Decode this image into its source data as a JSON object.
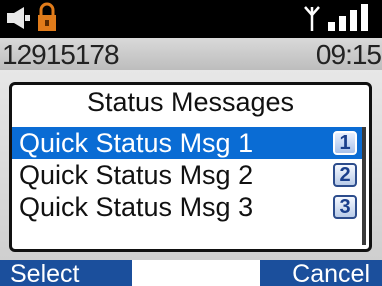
{
  "status_bar": {
    "icons": [
      "speaker-icon",
      "lock-icon",
      "antenna-icon",
      "signal-strength-icon"
    ],
    "colors": {
      "speaker": "#e8e8e8",
      "lock": "#e07b1a",
      "signal": "#ffffff"
    }
  },
  "info_row": {
    "number": "12915178",
    "time": "09:15"
  },
  "dialog": {
    "title": "Status Messages",
    "items": [
      {
        "label": "Quick Status Msg 1",
        "key": "1",
        "selected": true
      },
      {
        "label": "Quick Status Msg 2",
        "key": "2",
        "selected": false
      },
      {
        "label": "Quick Status Msg 3",
        "key": "3",
        "selected": false
      }
    ],
    "selection_color": "#0a6cd4"
  },
  "softkeys": {
    "left": "Select",
    "middle": "",
    "right": "Cancel",
    "color": "#1b4f9c"
  }
}
